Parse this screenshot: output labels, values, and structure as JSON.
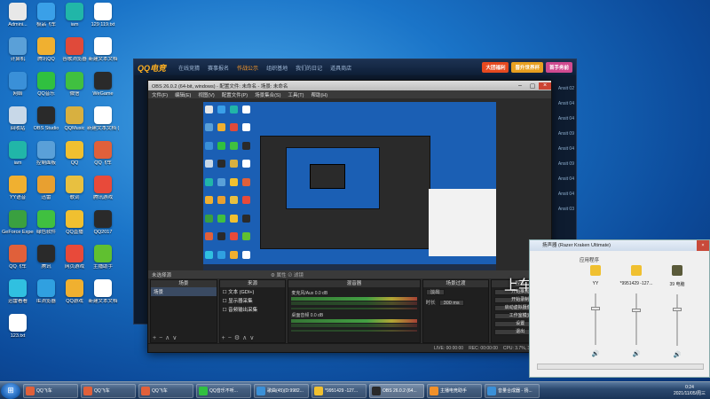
{
  "desktop_icons": [
    {
      "label": "Admini...",
      "color": "#e8e8e8"
    },
    {
      "label": "极品飞车",
      "color": "#3aa0e8"
    },
    {
      "label": "iam",
      "color": "#21b6a8"
    },
    {
      "label": "129 119.txt",
      "color": "#ffffff"
    },
    {
      "label": "计算机",
      "color": "#5aa0d8"
    },
    {
      "label": "腾讯QQ",
      "color": "#f0b030"
    },
    {
      "label": "谷歌浏览器",
      "color": "#e04a3a"
    },
    {
      "label": "新建文本文档",
      "color": "#ffffff"
    },
    {
      "label": "网络",
      "color": "#3a90d8"
    },
    {
      "label": "QQ音乐",
      "color": "#30c040"
    },
    {
      "label": "微信",
      "color": "#40c040"
    },
    {
      "label": "WeGame",
      "color": "#2a2a2a"
    },
    {
      "label": "回收站",
      "color": "#c8d8e8"
    },
    {
      "label": "OBS Studio",
      "color": "#2a2a2a"
    },
    {
      "label": "QQMusic",
      "color": "#d8b040"
    },
    {
      "label": "新建文本文档 (2).txt",
      "color": "#ffffff"
    },
    {
      "label": "iam",
      "color": "#21b6a8"
    },
    {
      "label": "控制面板",
      "color": "#5aa0d8"
    },
    {
      "label": "QQ",
      "color": "#f0c030"
    },
    {
      "label": "QQ飞车",
      "color": "#e0603a"
    },
    {
      "label": "YY语音",
      "color": "#f0b030"
    },
    {
      "label": "迅雷",
      "color": "#e8a030"
    },
    {
      "label": "歌词",
      "color": "#e8c040"
    },
    {
      "label": "腾讯游戏",
      "color": "#e84a3a"
    },
    {
      "label": "GeForce Experience",
      "color": "#3aa040"
    },
    {
      "label": "绿色软件",
      "color": "#40c040"
    },
    {
      "label": "QQ直播",
      "color": "#f0c030"
    },
    {
      "label": "QQ2017",
      "color": "#2a2a2a"
    },
    {
      "label": "QQ飞车",
      "color": "#e0603a"
    },
    {
      "label": "腾讯",
      "color": "#2a2a2a"
    },
    {
      "label": "网页游戏",
      "color": "#e84a3a"
    },
    {
      "label": "主播助手",
      "color": "#60c030"
    },
    {
      "label": "迅雷看看",
      "color": "#30c0e0"
    },
    {
      "label": "IE浏览器",
      "color": "#30a0e0"
    },
    {
      "label": "QQ游戏",
      "color": "#f0b030"
    },
    {
      "label": "新建文本文档",
      "color": "#ffffff"
    },
    {
      "label": "123.txt",
      "color": "#ffffff"
    }
  ],
  "game_client": {
    "logo": "QQ电竞",
    "nav": [
      "在线竞猜",
      "赛事报名",
      "作战公示",
      "组织基地",
      "我们的日记",
      "道具商店"
    ],
    "active_nav_index": 2,
    "buttons": [
      {
        "label": "大团福利",
        "color": "#e84a20"
      },
      {
        "label": "晋升世界杯",
        "color": "#e8a020"
      },
      {
        "label": "首手务前",
        "color": "#d04a90"
      }
    ],
    "side_labels": [
      "Ansit 02",
      "Ansit 04",
      "Ansit 04",
      "Ansit 09",
      "Ansit 04",
      "Ansit 09",
      "Ansit 04",
      "Ansit 04",
      "Ansit 03"
    ]
  },
  "obs": {
    "title": "OBS 26.0.2 (64-bit, windows) - 配置文件: 未命名 - 场景: 未命名",
    "menu": [
      "文件(F)",
      "编辑(E)",
      "视图(V)",
      "配置文件(P)",
      "场景集合(S)",
      "工具(T)",
      "帮助(H)"
    ],
    "source_strip_left": "未选择源",
    "source_strip_mid": "⚙ 属性   ⊘ 滤镜",
    "docks": {
      "scenes_header": "场景",
      "scenes": [
        "场景"
      ],
      "sources_header": "来源",
      "sources": [
        "文本 (GDI+)",
        "显示器采集",
        "音频输出采集"
      ],
      "mixer_header": "混音器",
      "mixer_tracks": [
        {
          "name": "麦克风/Aux",
          "level": "0.0 dB"
        },
        {
          "name": "桌面音频",
          "level": "0.0 dB"
        }
      ],
      "transition_header": "场景过渡",
      "transition_type": "淡出",
      "transition_duration_label": "时长",
      "transition_duration": "300 ms",
      "controls_header": "控件",
      "controls": [
        "开始推流",
        "开始录制",
        "启动虚拟摄像机",
        "工作室模式",
        "设置",
        "退出"
      ]
    },
    "status": {
      "live": "LIVE: 00:00:00",
      "rec": "REC: 00:00:00",
      "cpu": "CPU: 3.7%, 30.00 fps"
    }
  },
  "overlay_text": "上车加v:",
  "volume_mixer": {
    "title": "扬声器 (Razer Kraken Ultimate)",
    "group_label": "应用程序",
    "apps": [
      {
        "name": "YY",
        "color": "#f0c030",
        "level": 0.75
      },
      {
        "name": "*9951429 -127...",
        "color": "#f0c030",
        "level": 0.7
      },
      {
        "name": "39 电脑",
        "color": "#5a5a3a",
        "level": 0.75
      }
    ]
  },
  "taskbar": {
    "items": [
      {
        "label": "QQ飞车",
        "color": "#e0603a"
      },
      {
        "label": "QQ飞车",
        "color": "#e0603a"
      },
      {
        "label": "QQ飞车",
        "color": "#e0603a"
      },
      {
        "label": "QQ音乐不听...",
        "color": "#30c040"
      },
      {
        "label": "歌曲(45)(D:9982...",
        "color": "#3a90d8"
      },
      {
        "label": "*9951429 -127...",
        "color": "#f0c030"
      },
      {
        "label": "OBS 26.0.2 (64...",
        "color": "#2a2a2a"
      },
      {
        "label": "主播电竞助手",
        "color": "#f0902a"
      },
      {
        "label": "音量合成器 - 扬...",
        "color": "#3a90d8"
      }
    ],
    "active_index": 6,
    "time": "0:24",
    "date": "2021/11/05/周三"
  }
}
